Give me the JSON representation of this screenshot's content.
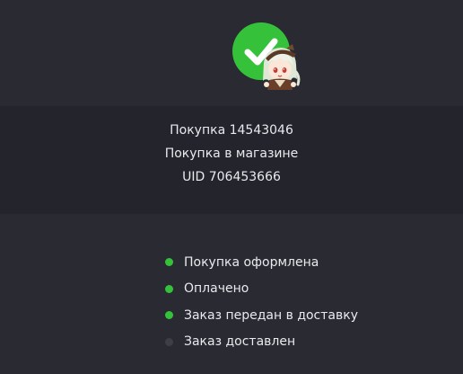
{
  "status": {
    "icon": "checkmark-icon",
    "color": "#35c23a"
  },
  "mascot": {
    "icon": "chibi-character-icon"
  },
  "purchase": {
    "number_line": "Покупка 14543046",
    "type_line": "Покупка в магазине",
    "uid_line": "UID 706453666"
  },
  "steps": [
    {
      "label": "Покупка оформлена",
      "done": true
    },
    {
      "label": "Оплачено",
      "done": true
    },
    {
      "label": "Заказ передан в доставку",
      "done": true
    },
    {
      "label": "Заказ доставлен",
      "done": false
    }
  ],
  "colors": {
    "done": "#35c23a",
    "pending": "#3e3e49"
  }
}
